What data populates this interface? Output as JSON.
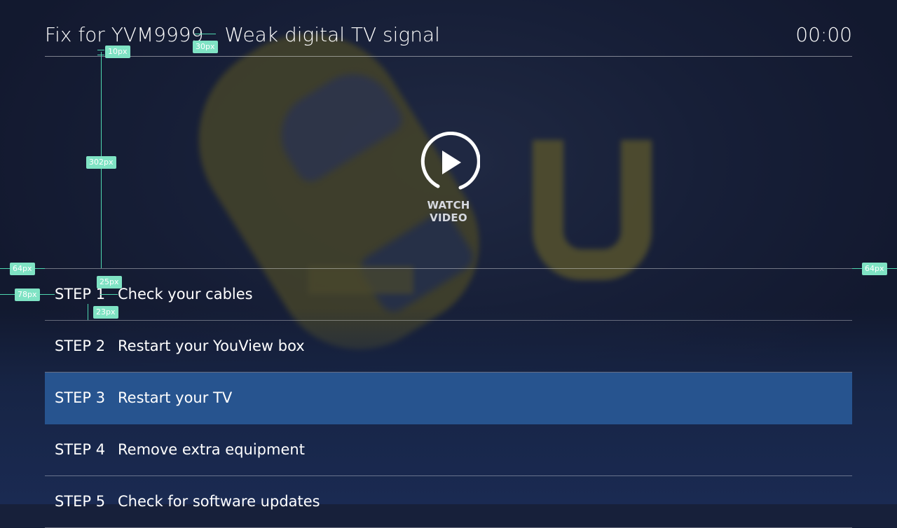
{
  "header": {
    "title_code": "Fix for YVM9999",
    "title_text": "Weak digital TV signal",
    "time": "00:00"
  },
  "video": {
    "watch_label": "WATCH VIDEO"
  },
  "steps": [
    {
      "num": "STEP 1",
      "text": "Check your cables"
    },
    {
      "num": "STEP 2",
      "text": "Restart your YouView box"
    },
    {
      "num": "STEP 3",
      "text": "Restart your TV"
    },
    {
      "num": "STEP 4",
      "text": "Remove extra equipment"
    },
    {
      "num": "STEP 5",
      "text": "Check for software updates"
    }
  ],
  "selected_step": 3,
  "annotations": [
    "10px",
    "30px",
    "302px",
    "64px",
    "64px",
    "78px",
    "25px",
    "23px"
  ],
  "colors": {
    "background": "#17203a",
    "selected": "#27548f",
    "annotation": "#7fe3c4"
  }
}
